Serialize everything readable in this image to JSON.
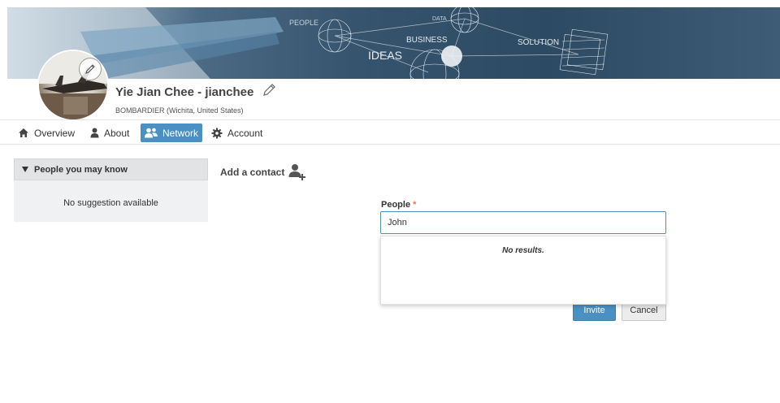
{
  "banner": {
    "words": [
      "PEOPLE",
      "DATA",
      "BUSINESS",
      "IDEAS",
      "SOLUTION"
    ]
  },
  "profile": {
    "name": "Yie Jian Chee - jianchee",
    "company": "BOMBARDIER (Wichita, United States)"
  },
  "nav": {
    "items": [
      {
        "label": "Overview",
        "icon": "home-icon"
      },
      {
        "label": "About",
        "icon": "user-icon"
      },
      {
        "label": "Network",
        "icon": "users-icon",
        "active": true
      },
      {
        "label": "Account",
        "icon": "gear-icon"
      }
    ]
  },
  "sidebar": {
    "title": "People you may know",
    "empty_text": "No suggestion available"
  },
  "add_contact": {
    "title": "Add a contact",
    "people_label": "People",
    "required_mark": "*",
    "people_value": "John",
    "dropdown_text": "No results.",
    "invite_label": "Invite",
    "cancel_label": "Cancel"
  },
  "colors": {
    "accent": "#4a90c2",
    "required": "#e07b39"
  }
}
